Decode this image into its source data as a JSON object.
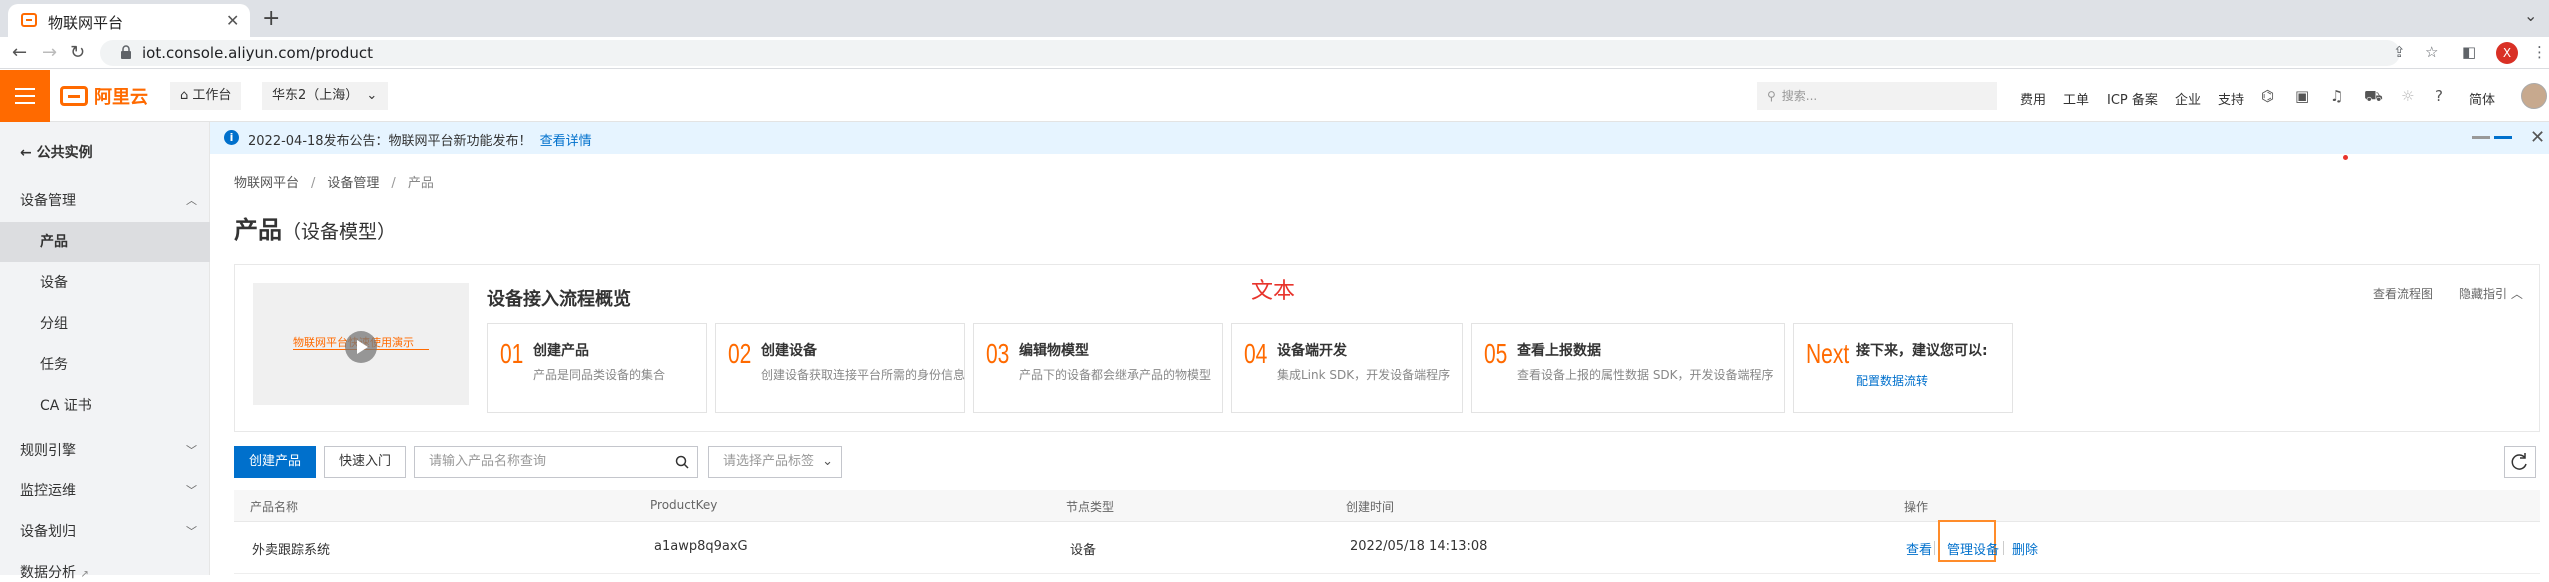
{
  "browser": {
    "tab_title": "物联网平台",
    "url": "iot.console.aliyun.com/product",
    "profile_initial": "X"
  },
  "topbar": {
    "logo": "阿里云",
    "workbench": "工作台",
    "region": "华东2（上海）",
    "search_placeholder": "搜索...",
    "links": [
      "费用",
      "工单",
      "ICP 备案",
      "企业",
      "支持"
    ],
    "language": "简体",
    "accent": "#ff6a00"
  },
  "sidebar": {
    "back": "公共实例",
    "group_device": "设备管理",
    "items": [
      "产品",
      "设备",
      "分组",
      "任务",
      "CA 证书"
    ],
    "active": "产品",
    "rules": "规则引擎",
    "monitor": "监控运维",
    "device_division": "设备划归",
    "data_analysis": "数据分析"
  },
  "notice": {
    "text": "2022-04-18发布公告：物联网平台新功能发布！",
    "link": "查看详情"
  },
  "breadcrumb": [
    "物联网平台",
    "设备管理",
    "产品"
  ],
  "page": {
    "title": "产品",
    "subtitle": "（设备模型）"
  },
  "flow": {
    "video_caption": "物联网平台快速使用演示",
    "title": "设备接入流程概览",
    "red_text": "文本",
    "view_flow": "查看流程图",
    "hide_guide": "隐藏指引",
    "steps": [
      {
        "num": "01",
        "title": "创建产品",
        "desc": "产品是同品类设备的集合"
      },
      {
        "num": "02",
        "title": "创建设备",
        "desc": "创建设备获取连接平台所需的身份信息"
      },
      {
        "num": "03",
        "title": "编辑物模型",
        "desc": "产品下的设备都会继承产品的物模型"
      },
      {
        "num": "04",
        "title": "设备端开发",
        "desc": "集成Link SDK，开发设备端程序"
      },
      {
        "num": "05",
        "title": "查看上报数据",
        "desc": "查看设备上报的属性数据 SDK，开发设备端程序"
      },
      {
        "num": "Next",
        "title": "接下来，建议您可以:",
        "link": "配置数据流转"
      }
    ]
  },
  "toolbar": {
    "create": "创建产品",
    "quick": "快速入门",
    "search_placeholder": "请输入产品名称查询",
    "tag_placeholder": "请选择产品标签"
  },
  "table": {
    "headers": [
      "产品名称",
      "ProductKey",
      "节点类型",
      "创建时间",
      "操作"
    ],
    "rows": [
      {
        "name": "外卖跟踪系统",
        "key": "a1awp8q9axG",
        "node": "设备",
        "created": "2022/05/18 14:13:08",
        "ops": [
          "查看",
          "管理设备",
          "删除"
        ]
      }
    ]
  }
}
